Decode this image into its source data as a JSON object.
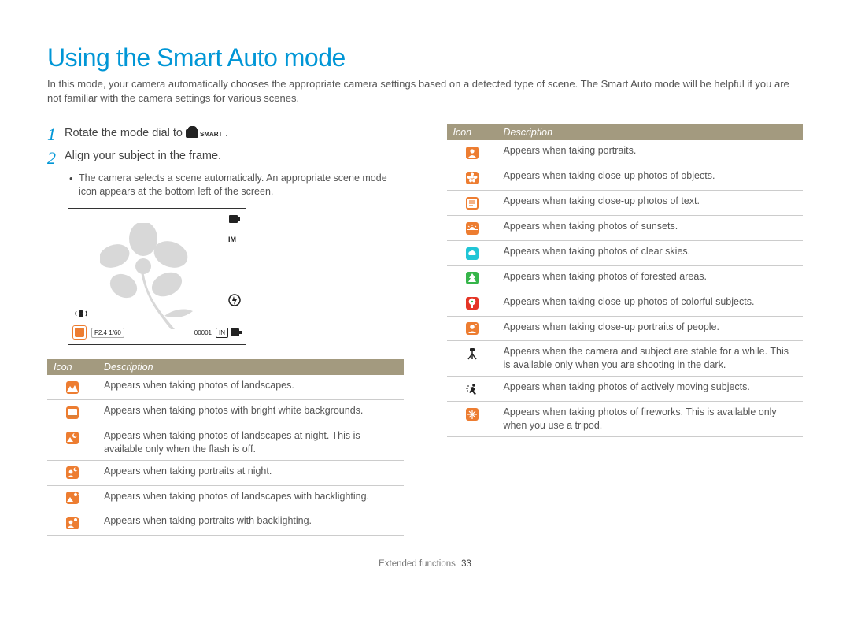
{
  "title": "Using the Smart Auto mode",
  "intro": "In this mode, your camera automatically chooses the appropriate camera settings based on a detected type of scene. The Smart Auto mode will be helpful if you are not familiar with the camera settings for various scenes.",
  "steps": {
    "one_num": "1",
    "one_text_a": "Rotate the mode dial to ",
    "one_text_b": ".",
    "smart_label": "SMART",
    "two_num": "2",
    "two_text": "Align your subject in the frame.",
    "two_bullet": "The camera selects a scene automatically. An appropriate scene mode icon appears at the bottom left of the screen."
  },
  "lcd": {
    "im": "IM",
    "exposure": "F2.4  1/60",
    "counter": "00001",
    "in": "IN"
  },
  "th_icon": "Icon",
  "th_desc": "Description",
  "left_rows": [
    {
      "icon": "landscape",
      "desc": "Appears when taking photos of landscapes."
    },
    {
      "icon": "white",
      "desc": "Appears when taking photos with bright white backgrounds."
    },
    {
      "icon": "night-land",
      "desc": "Appears when taking photos of landscapes at night. This is available only when the flash is off."
    },
    {
      "icon": "night-portrait",
      "desc": "Appears when taking portraits at night."
    },
    {
      "icon": "backlight-land",
      "desc": "Appears when taking photos of landscapes with backlighting."
    },
    {
      "icon": "backlight-portrait",
      "desc": "Appears when taking portraits with backlighting."
    }
  ],
  "right_rows": [
    {
      "icon": "portrait",
      "desc": "Appears when taking portraits."
    },
    {
      "icon": "macro",
      "desc": "Appears when taking close-up photos of objects."
    },
    {
      "icon": "macro-text",
      "desc": "Appears when taking close-up photos of text."
    },
    {
      "icon": "sunset",
      "desc": "Appears when taking photos of sunsets."
    },
    {
      "icon": "sky",
      "cls": "ico ico-cyan",
      "desc": "Appears when taking photos of clear skies."
    },
    {
      "icon": "forest",
      "cls": "ico ico-green",
      "desc": "Appears when taking photos of forested areas."
    },
    {
      "icon": "macro-color",
      "cls": "ico ico-red",
      "desc": "Appears when taking close-up photos of colorful subjects."
    },
    {
      "icon": "close-portrait",
      "desc": "Appears when taking close-up portraits of people."
    },
    {
      "icon": "tripod",
      "cls": "ico ico-black",
      "desc": "Appears when the camera and subject are stable for a while. This is available only when you are shooting in the dark."
    },
    {
      "icon": "action",
      "cls": "ico ico-black",
      "desc": "Appears when taking photos of actively moving subjects."
    },
    {
      "icon": "fireworks",
      "desc": "Appears when taking photos of fireworks. This is available only when you use a tripod."
    }
  ],
  "footer_label": "Extended functions",
  "footer_page": "33"
}
